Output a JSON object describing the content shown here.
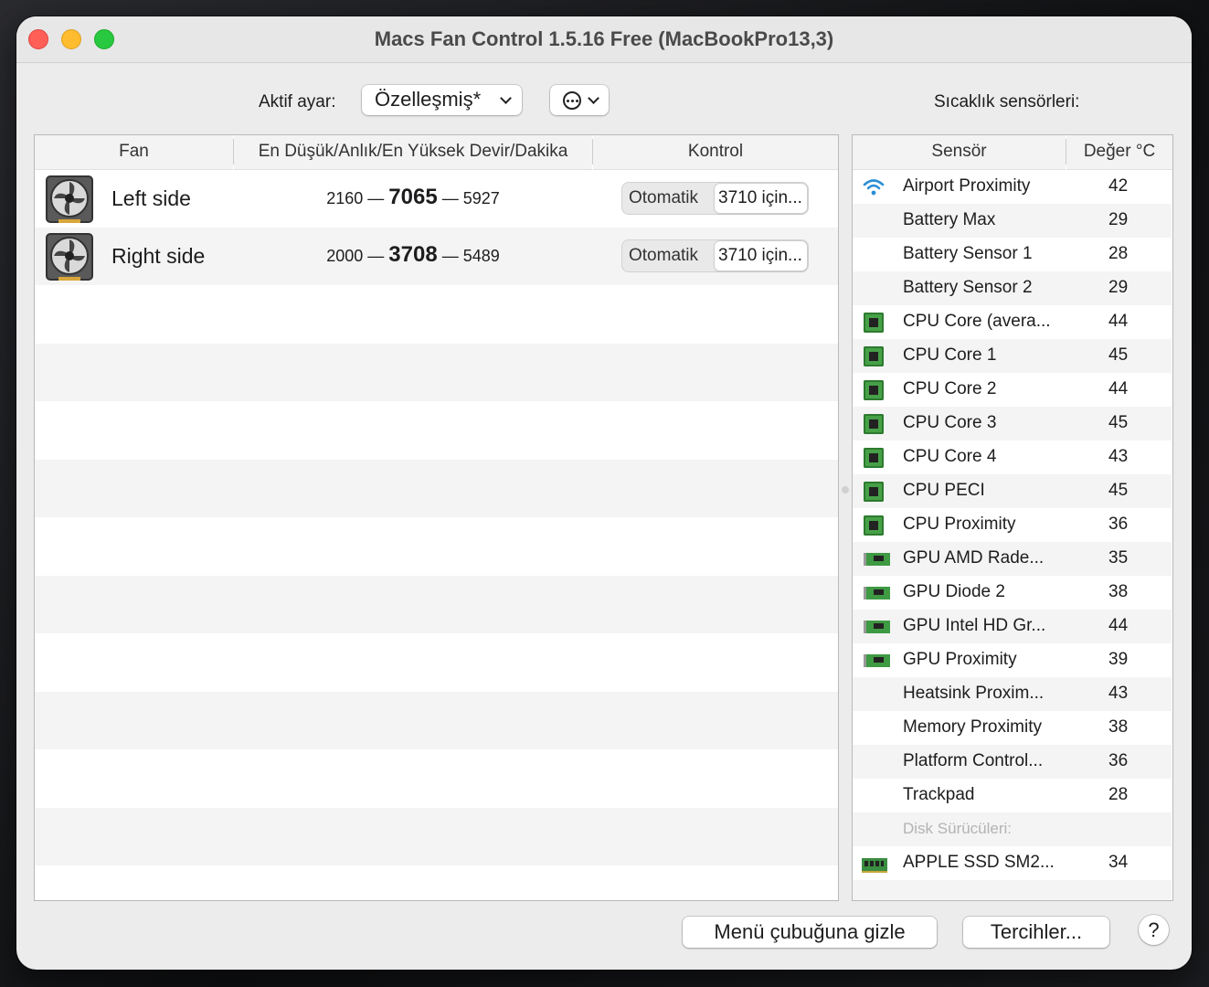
{
  "window": {
    "title": "Macs Fan Control 1.5.16 Free (MacBookPro13,3)"
  },
  "toolbar": {
    "active_preset_label": "Aktif ayar:",
    "active_preset_value": "Özelleşmiş*",
    "sensors_label": "Sıcaklık sensörleri:"
  },
  "fans": {
    "columns": [
      "Fan",
      "En Düşük/Anlık/En Yüksek Devir/Dakika",
      "Kontrol"
    ],
    "rows": [
      {
        "name": "Left side",
        "min": "2160",
        "current": "7065",
        "max": "5927",
        "mode": "Otomatik",
        "control": "3710 için..."
      },
      {
        "name": "Right side",
        "min": "2000",
        "current": "3708",
        "max": "5489",
        "mode": "Otomatik",
        "control": "3710 için..."
      }
    ],
    "dash": "—"
  },
  "sensors": {
    "columns": [
      "Sensör",
      "Değer °C"
    ],
    "rows": [
      {
        "icon": "wifi-icon",
        "name": "Airport Proximity",
        "value": "42"
      },
      {
        "icon": "",
        "name": "Battery Max",
        "value": "29"
      },
      {
        "icon": "",
        "name": "Battery Sensor 1",
        "value": "28"
      },
      {
        "icon": "",
        "name": "Battery Sensor 2",
        "value": "29"
      },
      {
        "icon": "cpu-icon",
        "name": "CPU Core (avera...",
        "value": "44"
      },
      {
        "icon": "cpu-icon",
        "name": "CPU Core 1",
        "value": "45"
      },
      {
        "icon": "cpu-icon",
        "name": "CPU Core 2",
        "value": "44"
      },
      {
        "icon": "cpu-icon",
        "name": "CPU Core 3",
        "value": "45"
      },
      {
        "icon": "cpu-icon",
        "name": "CPU Core 4",
        "value": "43"
      },
      {
        "icon": "cpu-icon",
        "name": "CPU PECI",
        "value": "45"
      },
      {
        "icon": "cpu-icon",
        "name": "CPU Proximity",
        "value": "36"
      },
      {
        "icon": "gpu-icon",
        "name": "GPU AMD Rade...",
        "value": "35"
      },
      {
        "icon": "gpu-icon",
        "name": "GPU Diode 2",
        "value": "38"
      },
      {
        "icon": "gpu-icon",
        "name": "GPU Intel HD Gr...",
        "value": "44"
      },
      {
        "icon": "gpu-icon",
        "name": "GPU Proximity",
        "value": "39"
      },
      {
        "icon": "",
        "name": "Heatsink Proxim...",
        "value": "43"
      },
      {
        "icon": "",
        "name": "Memory Proximity",
        "value": "38"
      },
      {
        "icon": "",
        "name": "Platform Control...",
        "value": "36"
      },
      {
        "icon": "",
        "name": "Trackpad",
        "value": "28"
      }
    ],
    "disk_section_label": "Disk Sürücüleri:",
    "disk_rows": [
      {
        "icon": "ssd-icon",
        "name": "APPLE SSD SM2...",
        "value": "34"
      }
    ]
  },
  "footer": {
    "hide_menubar_label": "Menü çubuğuna gizle",
    "preferences_label": "Tercihler...",
    "help_label": "?"
  }
}
